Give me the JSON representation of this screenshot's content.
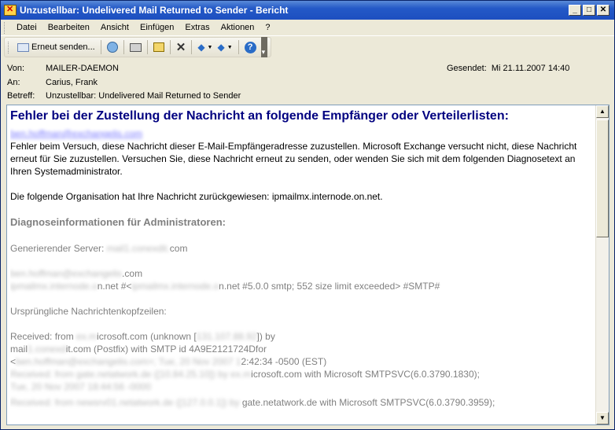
{
  "window": {
    "title": "Unzustellbar: Undelivered Mail Returned to Sender - Bericht",
    "controls": [
      "_",
      "□",
      "✕"
    ]
  },
  "menu": {
    "items": [
      "Datei",
      "Bearbeiten",
      "Ansicht",
      "Einfügen",
      "Extras",
      "Aktionen",
      "?"
    ]
  },
  "toolbar": {
    "resend_label": "Erneut senden...",
    "icons": [
      "resend-icon",
      "forward-icon",
      "print-icon",
      "move-icon",
      "delete-icon",
      "previous-icon",
      "next-icon",
      "help-icon"
    ]
  },
  "header": {
    "from_label": "Von:",
    "from_value": "MAILER-DAEMON",
    "to_label": "An:",
    "to_value": "Carius, Frank",
    "subject_label": "Betreff:",
    "subject_value": "Unzustellbar: Undelivered Mail Returned to Sender",
    "sent_label": "Gesendet:",
    "sent_value": "Mi 21.11.2007 14:40"
  },
  "body": {
    "heading": "Fehler bei der Zustellung der Nachricht an folgende Empfänger oder Verteilerlisten:",
    "recipient_link": "ben.hoffman@exchangelis.com",
    "para1": "Fehler beim Versuch, diese Nachricht dieser E-Mail-Empfängeradresse zuzustellen. Microsoft Exchange versucht nicht, diese Nachricht erneut für Sie zuzustellen. Versuchen Sie, diese Nachricht erneut zu senden, oder wenden Sie sich mit dem folgenden Diagnosetext an Ihren Systemadministrator.",
    "para2": "Die folgende Organisation hat Ihre Nachricht zurückgewiesen: ipmailmx.internode.on.net.",
    "diag_heading": "Diagnoseinformationen für Administratoren:",
    "gen_server_label": "Generierender Server:",
    "gen_server_hidden": "mail1.conexdit.",
    "gen_server_visible": "com",
    "addr_hidden": "ben.hoffman@exchangelis",
    "addr_visible": ".com",
    "smtp_hidden_a": "ipmailmx.internode.o",
    "smtp_visible_a": "n.net #<",
    "smtp_hidden_b": "ipmailmx.internode.o",
    "smtp_visible_b": "n.net #5.0.0 smtp; 552 size limit exceeded> #SMTP#",
    "orig_headers_label": "Ursprüngliche Nachrichtenkopfzeilen:",
    "recv1_a": "Received: from ",
    "recv1_hidden": "ex.m",
    "recv1_b": "icrosoft.com (unknown [",
    "recv1_hidden2": "131.107.88.92",
    "recv1_c": "])  by",
    "recv2_a": " mail",
    "recv2_hidden": "1.conexd",
    "recv2_b": "it.com (Postfix) with SMTP id 4A9E2121724Dfor",
    "recv3_a": " <",
    "recv3_hidden": "ben.hoffman@exchangelis.com>; Tue, 20 Nov 2007 1",
    "recv3_b": "2:42:34 -0500 (EST)",
    "recv4_hidden": "Received: from gate.netatwork.de ([10.84.25.10]) by ex.m",
    "recv4_b": "icrosoft.com with Microsoft SMTPSVC(6.0.3790.1830);",
    "recv5_hidden": "       Tue, 20 Nov 2007 18:44:56 -0000",
    "recv6_hidden": "Received: from newsrv01.netatwork.de ([127.0.0.1]) by ",
    "recv6_b": "gate.netatwork.de with Microsoft SMTPSVC(6.0.3790.3959);"
  }
}
